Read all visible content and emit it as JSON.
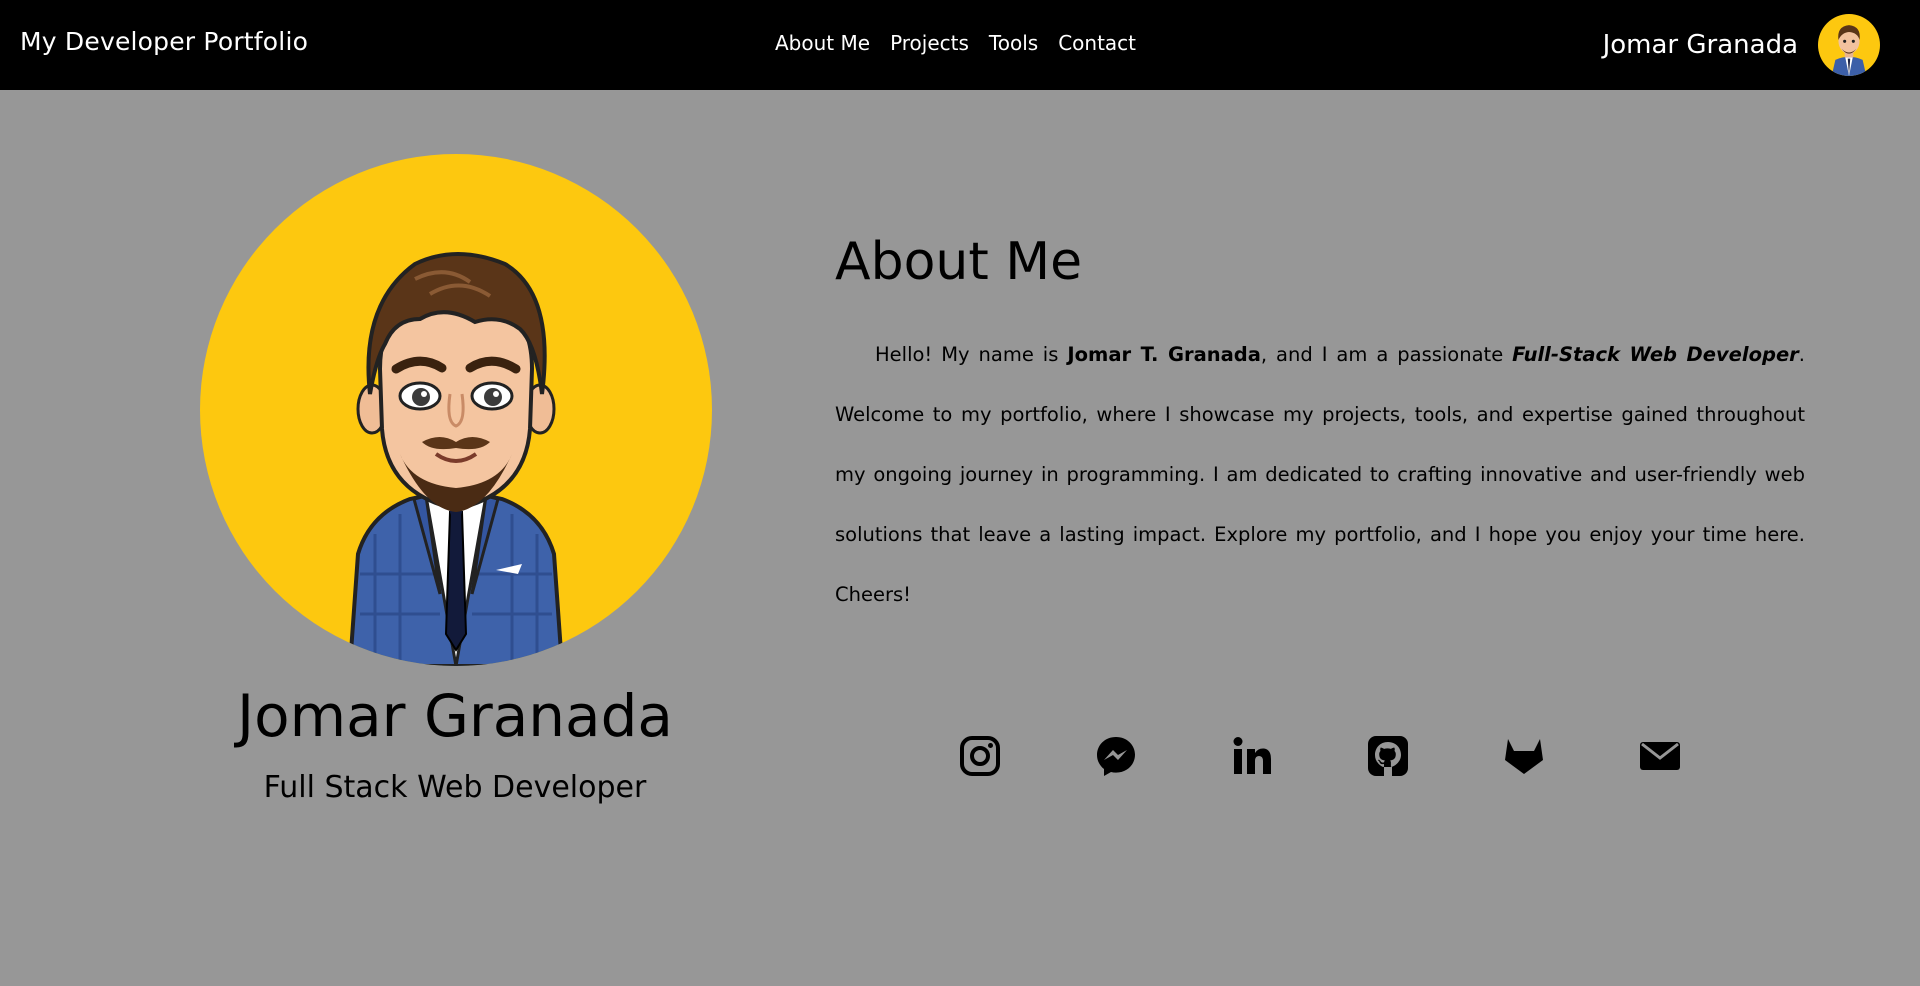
{
  "navbar": {
    "brand": "My Developer Portfolio",
    "links": [
      {
        "label": "About Me"
      },
      {
        "label": "Projects"
      },
      {
        "label": "Tools"
      },
      {
        "label": "Contact"
      }
    ],
    "user_name": "Jomar Granada",
    "avatar_icon": "avatar-icon"
  },
  "profile": {
    "name": "Jomar Granada",
    "role": "Full Stack Web Developer",
    "avatar_bg": "#fdc80f"
  },
  "about": {
    "title": "About Me",
    "intro": "Hello! My name is ",
    "full_name": "Jomar T. Granada",
    "mid": ", and I am a passionate ",
    "role_emphasis": "Full-Stack Web Developer",
    "rest": ". Welcome to my portfolio, where I showcase my projects, tools, and expertise gained throughout my ongoing journey in programming. I am dedicated to crafting innovative and user-friendly web solutions that leave a lasting impact. Explore my portfolio, and I hope you enjoy your time here. Cheers!"
  },
  "social_links": [
    {
      "icon": "instagram-icon"
    },
    {
      "icon": "messenger-icon"
    },
    {
      "icon": "linkedin-icon"
    },
    {
      "icon": "github-icon"
    },
    {
      "icon": "gitlab-icon"
    },
    {
      "icon": "email-icon"
    }
  ],
  "colors": {
    "navbar_bg": "#000000",
    "page_bg": "#979797",
    "accent": "#fdc80f"
  }
}
